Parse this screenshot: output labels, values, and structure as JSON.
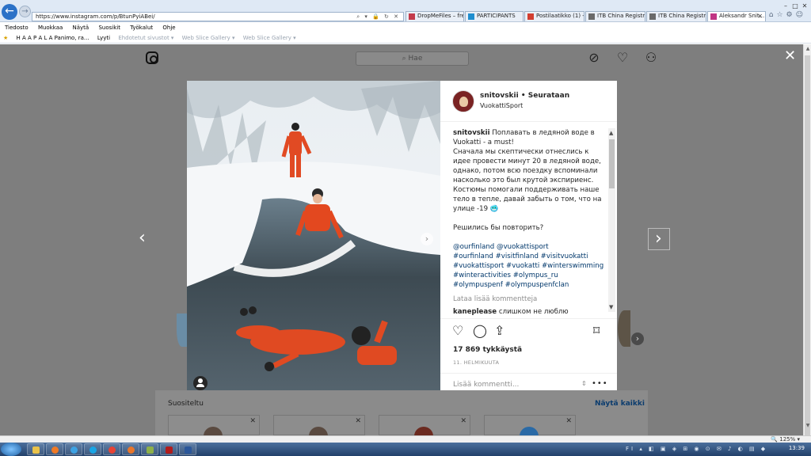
{
  "browser": {
    "address": "https://www.instagram.com/p/BtunPyiABei/",
    "tabs": [
      {
        "label": "DropMeFiles – free ...",
        "color": "#c33b4b"
      },
      {
        "label": "PARTICIPANTS",
        "color": "#1f8ecf"
      },
      {
        "label": "Postilaatikko (1) - a...",
        "color": "#d23f31"
      },
      {
        "label": "ITB China Registrati...",
        "color": "#6a6a6a"
      },
      {
        "label": "ITB China Registrati...",
        "color": "#6a6a6a"
      },
      {
        "label": "Aleksandr Snit...",
        "color": "#c13584"
      }
    ],
    "menu": [
      "Tiedosto",
      "Muokkaa",
      "Näytä",
      "Suosikit",
      "Työkalut",
      "Ohje"
    ],
    "favorites": [
      {
        "label": "H A A P A L A  Panimo, ra..."
      },
      {
        "label": "Lyyti"
      },
      {
        "label": "Ehdotetut sivustot ▾"
      },
      {
        "label": "Web Slice Gallery ▾"
      },
      {
        "label": "Web Slice Gallery ▾"
      }
    ],
    "zoom": "125%",
    "clock": "13:39"
  },
  "instagram": {
    "search_placeholder": "Hae",
    "post": {
      "username": "snitovskii",
      "follow_text": "Seurataan",
      "location": "VuokattiSport",
      "caption_user": "snitovskii",
      "caption_lines": [
        "Поплавать в ледяной воде в Vuokatti - a must!",
        "Сначала мы скептически отнеслись к идее провести минут 20 в ледяной воде, однако, потом всю поездку вспоминали насколько это был крутой экспириенс. Костюмы помогали поддерживать наше тело в тепле, давай забыть о том, что на улице -19 🥶"
      ],
      "question": "Решились бы повторить?",
      "mentions": "@ourfinland @vuokattisport",
      "hashtags": "#ourfinland #visitfinland #visitvuokatti #vuokattisport #vuokatti #winterswimming #winteractivities #olympus_ru #olympuspenf #olympuspenfclan",
      "load_more": "Lataa lisää kommentteja",
      "first_comment_user": "kaneplease",
      "first_comment_text": "слишком не люблю",
      "likes": "17 869 tykkäystä",
      "date": "11. HELMIKUUTA",
      "comment_placeholder": "Lisää kommentti..."
    },
    "suggestions": {
      "title": "Suositeltu",
      "see_all": "Näytä kaikki"
    }
  }
}
